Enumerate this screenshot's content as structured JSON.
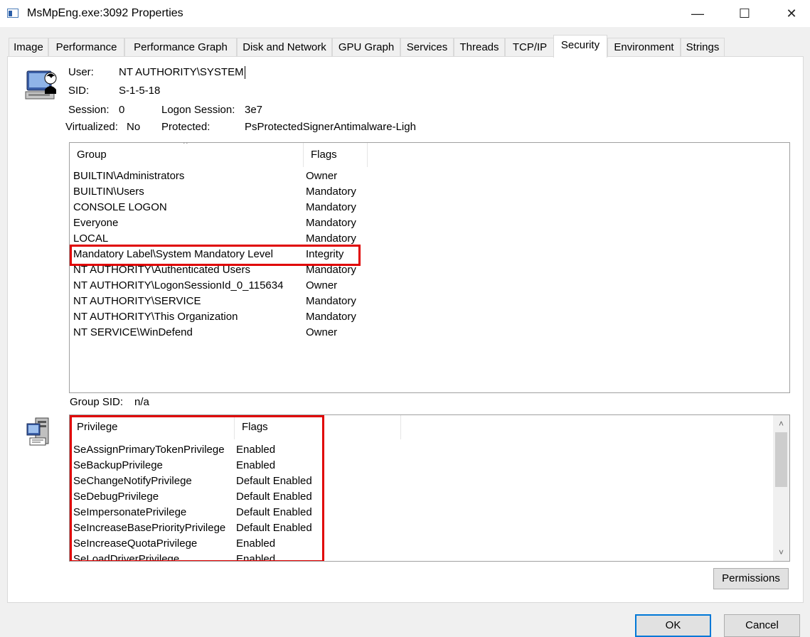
{
  "window": {
    "title": "MsMpEng.exe:3092 Properties",
    "minimize": "—",
    "maximize": "☐",
    "close": "✕"
  },
  "tabs": [
    "Image",
    "Performance",
    "Performance Graph",
    "Disk and Network",
    "GPU Graph",
    "Services",
    "Threads",
    "TCP/IP",
    "Security",
    "Environment",
    "Strings"
  ],
  "active_tab": "Security",
  "token": {
    "user_label": "User:",
    "user_value": "NT AUTHORITY\\SYSTEM",
    "sid_label": "SID:",
    "sid_value": "S-1-5-18",
    "session_label": "Session:",
    "session_value": "0",
    "logon_label": "Logon Session:",
    "logon_value": "3e7",
    "virtualized_label": "Virtualized:",
    "virtualized_value": "No",
    "protected_label": "Protected:",
    "protected_value": "PsProtectedSignerAntimalware-Ligh"
  },
  "groups": {
    "columns": [
      "Group",
      "Flags"
    ],
    "rows": [
      [
        "BUILTIN\\Administrators",
        "Owner"
      ],
      [
        "BUILTIN\\Users",
        "Mandatory"
      ],
      [
        "CONSOLE LOGON",
        "Mandatory"
      ],
      [
        "Everyone",
        "Mandatory"
      ],
      [
        "LOCAL",
        "Mandatory"
      ],
      [
        "Mandatory Label\\System Mandatory Level",
        "Integrity"
      ],
      [
        "NT AUTHORITY\\Authenticated Users",
        "Mandatory"
      ],
      [
        "NT AUTHORITY\\LogonSessionId_0_115634",
        "Owner"
      ],
      [
        "NT AUTHORITY\\SERVICE",
        "Mandatory"
      ],
      [
        "NT AUTHORITY\\This Organization",
        "Mandatory"
      ],
      [
        "NT SERVICE\\WinDefend",
        "Owner"
      ]
    ],
    "sort_indicator": "^"
  },
  "group_sid": {
    "label": "Group SID:",
    "value": "n/a"
  },
  "privileges": {
    "columns": [
      "Privilege",
      "Flags"
    ],
    "rows": [
      [
        "SeAssignPrimaryTokenPrivilege",
        "Enabled"
      ],
      [
        "SeBackupPrivilege",
        "Enabled"
      ],
      [
        "SeChangeNotifyPrivilege",
        "Default Enabled"
      ],
      [
        "SeDebugPrivilege",
        "Default Enabled"
      ],
      [
        "SeImpersonatePrivilege",
        "Default Enabled"
      ],
      [
        "SeIncreaseBasePriorityPrivilege",
        "Default Enabled"
      ],
      [
        "SeIncreaseQuotaPrivilege",
        "Enabled"
      ],
      [
        "SeLoadDriverPrivilege",
        "Enabled"
      ]
    ]
  },
  "buttons": {
    "permissions": "Permissions",
    "ok": "OK",
    "cancel": "Cancel"
  },
  "colors": {
    "highlight_box": "#e00000",
    "default_button_border": "#0078d7"
  },
  "icons": {
    "user_token": "user-computer-icon",
    "privileges": "privilege-computer-icon",
    "scroll_up": "chevron-up-icon",
    "scroll_down": "chevron-down-icon"
  }
}
